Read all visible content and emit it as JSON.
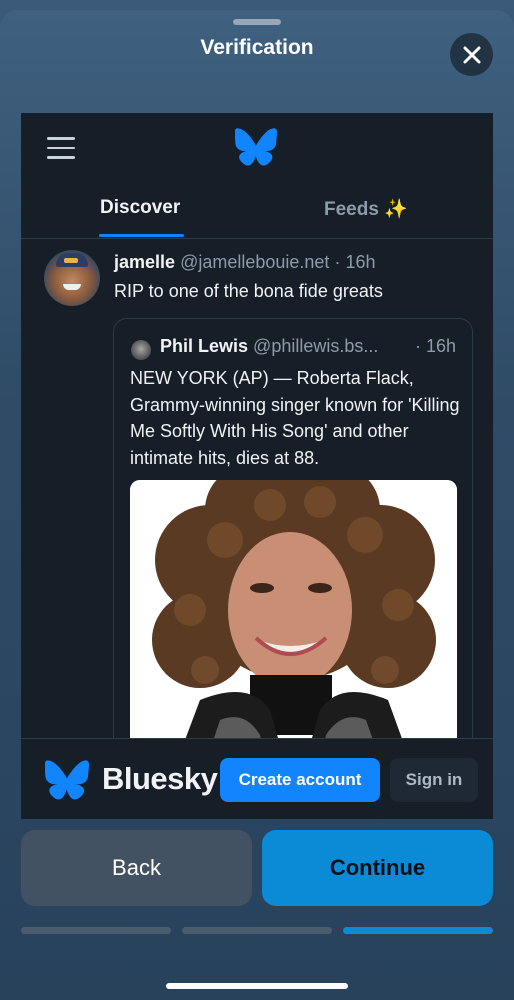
{
  "sheet": {
    "title": "Verification",
    "close_icon": "close-icon"
  },
  "bluesky": {
    "tabs": [
      {
        "label": "Discover",
        "active": true
      },
      {
        "label": "Feeds ✨",
        "active": false
      }
    ],
    "post": {
      "author": "jamelle",
      "handle": "@jamellebouie.net",
      "separator": "·",
      "time": "16h",
      "text": "RIP to one of the bona fide greats",
      "quote": {
        "author": "Phil Lewis",
        "handle": "@phillewis.bs...",
        "separator": "·",
        "time": "16h",
        "text": "NEW YORK (AP) — Roberta Flack, Grammy-winning singer known for 'Killing Me Softly With His Song' and other intimate hits, dies at 88."
      }
    },
    "footer": {
      "brand": "Bluesky",
      "create_account": "Create account",
      "sign_in": "Sign in"
    }
  },
  "actions": {
    "back": "Back",
    "continue": "Continue"
  },
  "progress": {
    "total_steps": 3,
    "current_step": 3
  },
  "colors": {
    "accent": "#1185fe",
    "continue": "#0b8bd6",
    "webview_bg": "#161e27"
  }
}
